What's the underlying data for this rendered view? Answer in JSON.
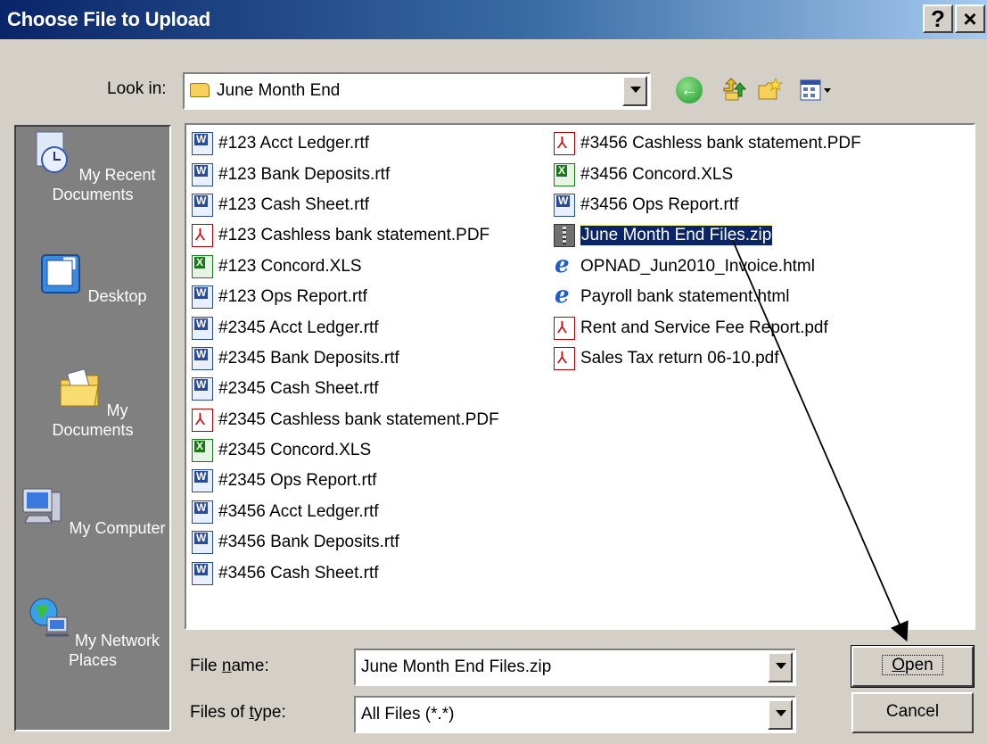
{
  "window": {
    "title": "Choose File to Upload",
    "help_label": "?",
    "close_label": "×"
  },
  "lookin": {
    "label": "Look in:",
    "value": "June Month End"
  },
  "places": [
    {
      "label": "My Recent Documents",
      "icon": "recent-documents-icon"
    },
    {
      "label": "Desktop",
      "icon": "desktop-icon"
    },
    {
      "label": "My Documents",
      "icon": "my-documents-icon"
    },
    {
      "label": "My Computer",
      "icon": "my-computer-icon"
    },
    {
      "label": "My Network Places",
      "icon": "network-places-icon"
    }
  ],
  "files": {
    "column1": [
      {
        "name": "#123 Acct Ledger.rtf",
        "type": "rtf"
      },
      {
        "name": "#123 Bank Deposits.rtf",
        "type": "rtf"
      },
      {
        "name": "#123 Cash Sheet.rtf",
        "type": "rtf"
      },
      {
        "name": "#123 Cashless bank statement.PDF",
        "type": "pdf"
      },
      {
        "name": "#123 Concord.XLS",
        "type": "xls"
      },
      {
        "name": "#123 Ops Report.rtf",
        "type": "rtf"
      },
      {
        "name": "#2345 Acct Ledger.rtf",
        "type": "rtf"
      },
      {
        "name": "#2345 Bank Deposits.rtf",
        "type": "rtf"
      },
      {
        "name": "#2345 Cash Sheet.rtf",
        "type": "rtf"
      },
      {
        "name": "#2345 Cashless bank statement.PDF",
        "type": "pdf"
      },
      {
        "name": "#2345 Concord.XLS",
        "type": "xls"
      },
      {
        "name": "#2345 Ops Report.rtf",
        "type": "rtf"
      },
      {
        "name": "#3456 Acct Ledger.rtf",
        "type": "rtf"
      },
      {
        "name": "#3456 Bank Deposits.rtf",
        "type": "rtf"
      },
      {
        "name": "#3456 Cash Sheet.rtf",
        "type": "rtf"
      }
    ],
    "column2": [
      {
        "name": "#3456 Cashless bank statement.PDF",
        "type": "pdf"
      },
      {
        "name": "#3456 Concord.XLS",
        "type": "xls"
      },
      {
        "name": "#3456 Ops Report.rtf",
        "type": "rtf"
      },
      {
        "name": "June Month End Files.zip",
        "type": "zip",
        "selected": true
      },
      {
        "name": "OPNAD_Jun2010_Invoice.html",
        "type": "html"
      },
      {
        "name": "Payroll bank statement.html",
        "type": "html"
      },
      {
        "name": "Rent and Service Fee Report.pdf",
        "type": "pdf"
      },
      {
        "name": "Sales Tax return 06-10.pdf",
        "type": "pdf"
      }
    ]
  },
  "filename": {
    "label_pre": "File ",
    "label_key": "n",
    "label_post": "ame:",
    "value": "June Month End Files.zip"
  },
  "filetype": {
    "label_pre": "Files of ",
    "label_key": "t",
    "label_post": "ype:",
    "value": "All Files (*.*)"
  },
  "buttons": {
    "open_key": "O",
    "open_rest": "pen",
    "cancel": "Cancel"
  }
}
